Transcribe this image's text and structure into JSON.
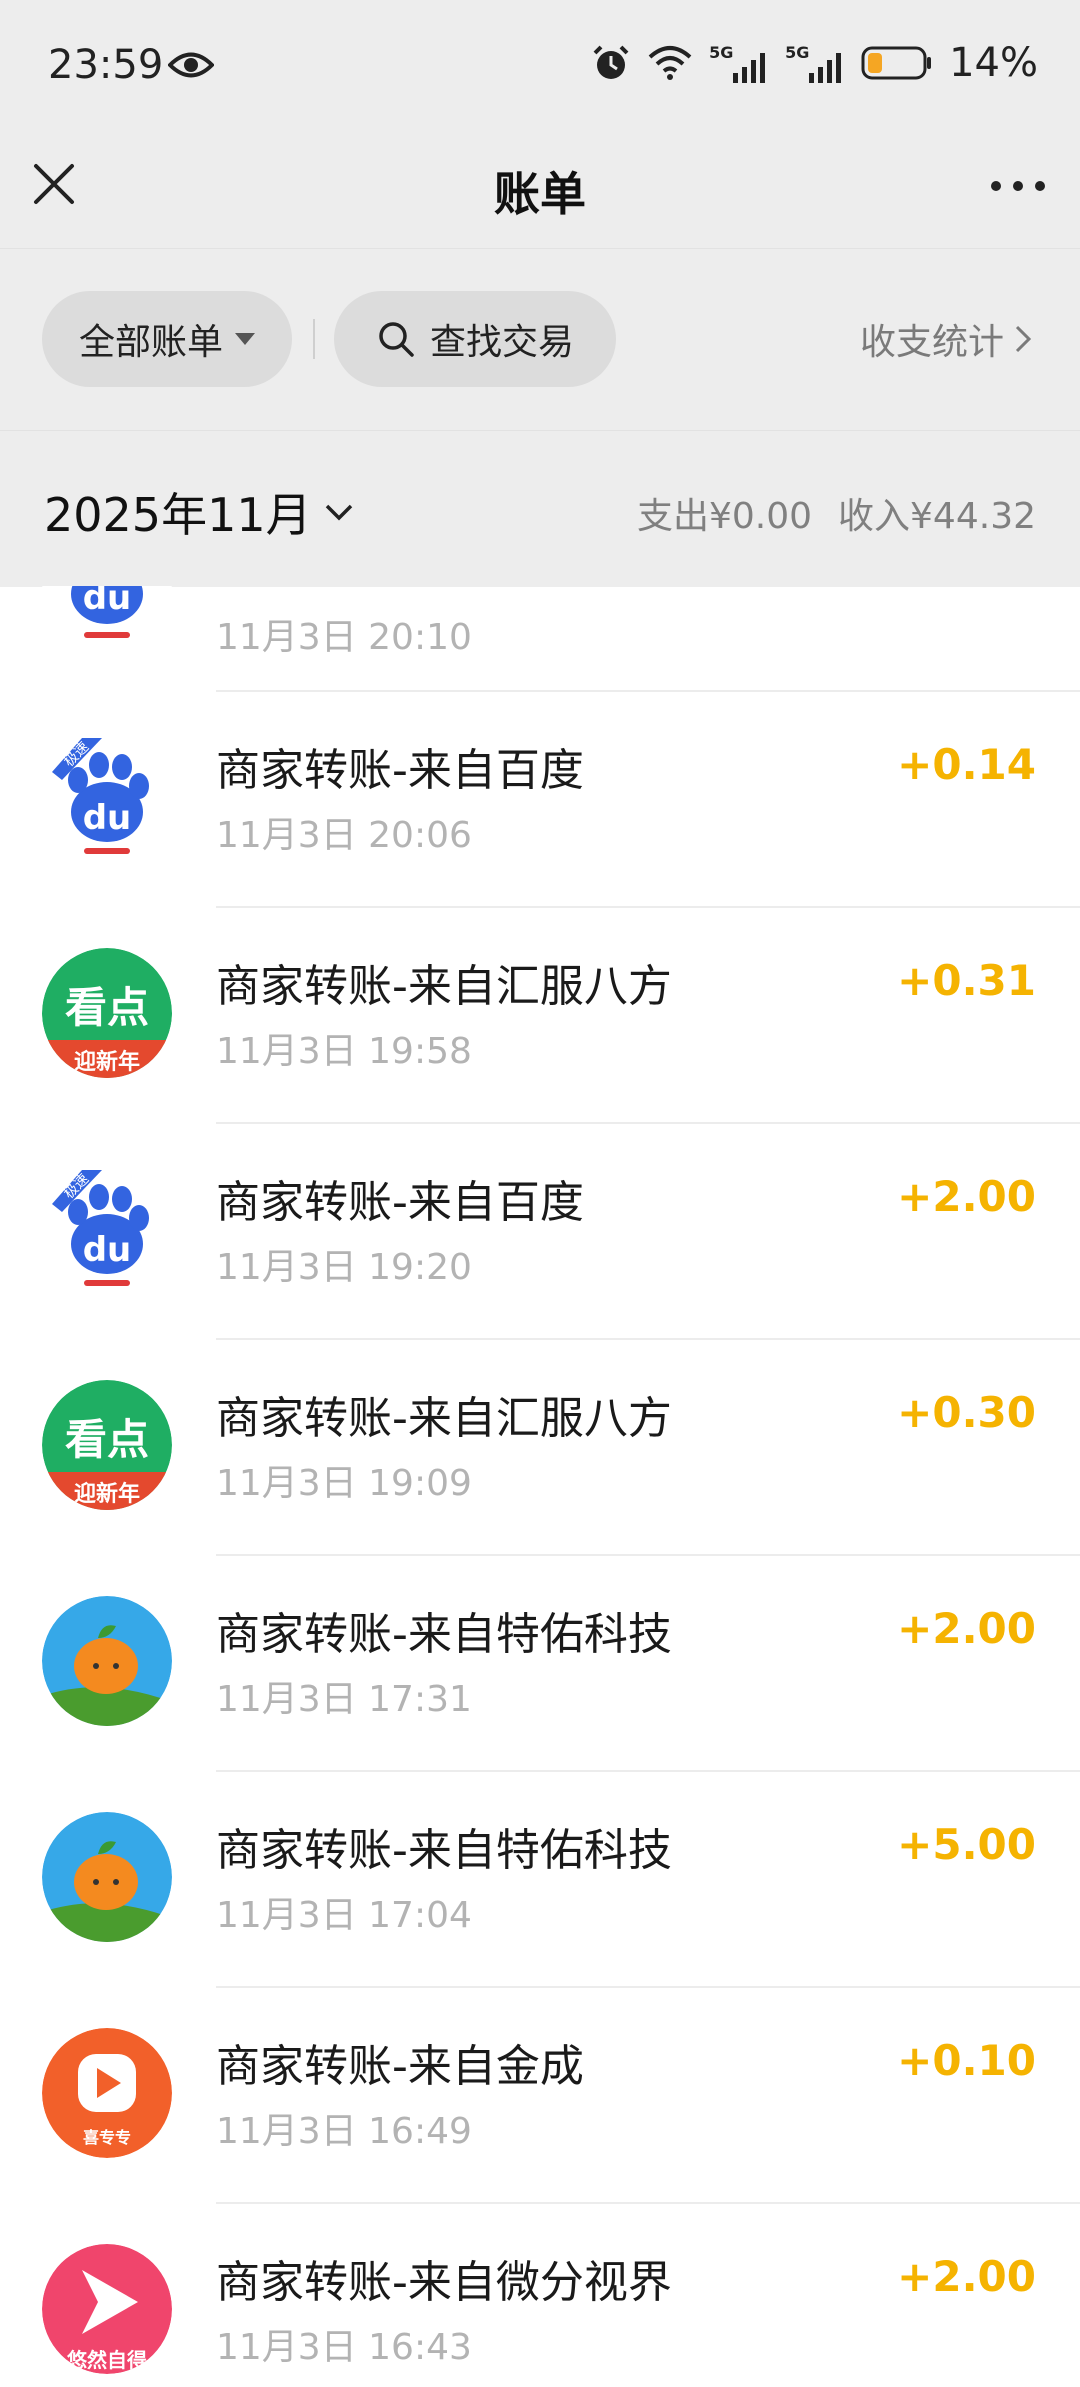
{
  "status": {
    "time": "23:59",
    "battery": "14%",
    "network": [
      "5G",
      "5G"
    ]
  },
  "nav": {
    "title": "账单"
  },
  "filters": {
    "all_bills": "全部账单",
    "search": "查找交易",
    "stats": "收支统计"
  },
  "month": {
    "label": "2025年11月",
    "expense": "支出¥0.00",
    "income": "收入¥44.32"
  },
  "partial_row": {
    "time": "11月3日 20:10",
    "icon": "baidu-logo"
  },
  "transactions": [
    {
      "title": "商家转账-来自百度",
      "time": "11月3日 20:06",
      "amount": "+0.14",
      "icon": "baidu-logo"
    },
    {
      "title": "商家转账-来自汇服八方",
      "time": "11月3日 19:58",
      "amount": "+0.31",
      "icon": "kandian-logo"
    },
    {
      "title": "商家转账-来自百度",
      "time": "11月3日 19:20",
      "amount": "+2.00",
      "icon": "baidu-logo"
    },
    {
      "title": "商家转账-来自汇服八方",
      "time": "11月3日 19:09",
      "amount": "+0.30",
      "icon": "kandian-logo"
    },
    {
      "title": "商家转账-来自特佑科技",
      "time": "11月3日 17:31",
      "amount": "+2.00",
      "icon": "orange-logo"
    },
    {
      "title": "商家转账-来自特佑科技",
      "time": "11月3日 17:04",
      "amount": "+5.00",
      "icon": "orange-logo"
    },
    {
      "title": "商家转账-来自金成",
      "time": "11月3日 16:49",
      "amount": "+0.10",
      "icon": "play-logo"
    },
    {
      "title": "商家转账-来自微分视界",
      "time": "11月3日 16:43",
      "amount": "+2.00",
      "icon": "youran-logo"
    }
  ],
  "logo_text": {
    "baidu": "du",
    "baidu_badge": "极速",
    "kandian_main": "看点",
    "kandian_sub": "迎新年",
    "play_sub": "喜专专",
    "youran_sub": "悠然自得"
  },
  "colors": {
    "amount": "#f5b301",
    "bar_bg": "#ededed"
  }
}
